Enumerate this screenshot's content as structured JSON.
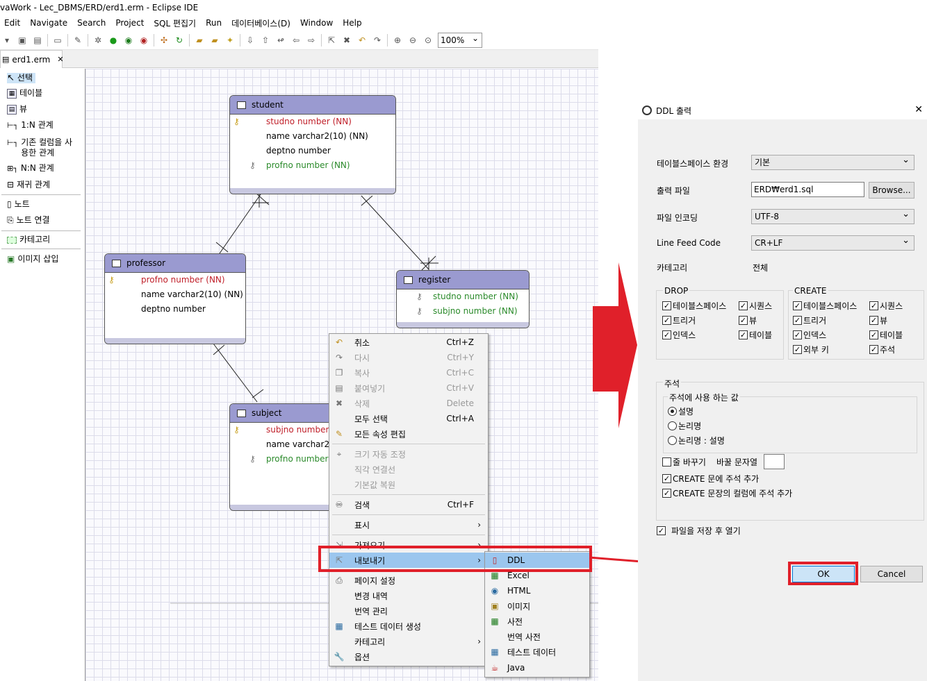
{
  "window": {
    "title": "vaWork - Lec_DBMS/ERD/erd1.erm - Eclipse IDE"
  },
  "menubar": [
    "Edit",
    "Navigate",
    "Search",
    "Project",
    "SQL 편집기",
    "Run",
    "데이터베이스(D)",
    "Window",
    "Help"
  ],
  "toolbar": {
    "zoom": "100%"
  },
  "editor_tab": {
    "label": "erd1.erm"
  },
  "palette": {
    "items": [
      "선택",
      "테이블",
      "뷰",
      "1:N 관계",
      "기존 컬럼을 사용한 관계",
      "N:N 관계",
      "재귀 관계",
      "노트",
      "노트 연결",
      "카테고리",
      "이미지 삽입"
    ],
    "item5_line1": "기존 컬럼을 사",
    "item5_line2": "용한 관계"
  },
  "entities": {
    "student": {
      "name": "student",
      "cols": [
        "studno number (NN)",
        "name varchar2(10) (NN)",
        "deptno number",
        "profno number (NN)"
      ]
    },
    "professor": {
      "name": "professor",
      "cols": [
        "profno number (NN)",
        "name varchar2(10) (NN)",
        "deptno number"
      ]
    },
    "register": {
      "name": "register",
      "cols": [
        "studno number (NN)",
        "subjno number (NN)"
      ]
    },
    "subject": {
      "name": "subject",
      "cols": [
        "subjno number (",
        "name varchar2(1",
        "profno number ("
      ]
    }
  },
  "context_menu": {
    "items": [
      {
        "label": "취소",
        "shortcut": "Ctrl+Z"
      },
      {
        "label": "다시",
        "shortcut": "Ctrl+Y"
      },
      {
        "label": "복사",
        "shortcut": "Ctrl+C"
      },
      {
        "label": "붙여넣기",
        "shortcut": "Ctrl+V"
      },
      {
        "label": "삭제",
        "shortcut": "Delete"
      },
      {
        "label": "모두 선택",
        "shortcut": "Ctrl+A"
      },
      {
        "label": "모든 속성 편집",
        "shortcut": ""
      },
      {
        "label": "크기 자동 조정",
        "shortcut": ""
      },
      {
        "label": "직각 연결선",
        "shortcut": ""
      },
      {
        "label": "기본값 복원",
        "shortcut": ""
      },
      {
        "label": "검색",
        "shortcut": "Ctrl+F"
      },
      {
        "label": "표시",
        "shortcut": ""
      },
      {
        "label": "가져오기",
        "shortcut": ""
      },
      {
        "label": "내보내기",
        "shortcut": ""
      },
      {
        "label": "페이지 설정",
        "shortcut": ""
      },
      {
        "label": "변경 내역",
        "shortcut": ""
      },
      {
        "label": "번역 관리",
        "shortcut": ""
      },
      {
        "label": "테스트 데이터 생성",
        "shortcut": ""
      },
      {
        "label": "카테고리",
        "shortcut": ""
      },
      {
        "label": "옵션",
        "shortcut": ""
      }
    ]
  },
  "export_submenu": {
    "items": [
      "DDL",
      "Excel",
      "HTML",
      "이미지",
      "사전",
      "번역 사전",
      "테스트 데이터",
      "Java"
    ]
  },
  "dialog": {
    "title": "DDL 출력",
    "tablespace_label": "테이블스페이스 환경",
    "tablespace_value": "기본",
    "output_file_label": "출력 파일",
    "output_file_value": "ERD₩erd1.sql",
    "browse_label": "Browse...",
    "encoding_label": "파일 인코딩",
    "encoding_value": "UTF-8",
    "linefeed_label": "Line Feed Code",
    "linefeed_value": "CR+LF",
    "category_label": "카테고리",
    "category_value": "전체",
    "drop": {
      "title": "DROP",
      "items": [
        "테이블스페이스",
        "시퀀스",
        "트리거",
        "뷰",
        "인덱스",
        "테이블"
      ]
    },
    "create": {
      "title": "CREATE",
      "items": [
        "테이블스페이스",
        "시퀀스",
        "트리거",
        "뷰",
        "인덱스",
        "테이블",
        "외부 키",
        "주석"
      ]
    },
    "comment": {
      "title": "주석",
      "value_title": "주석에 사용 하는 값",
      "options": [
        "설명",
        "논리명",
        "논리명 : 설명"
      ],
      "selected": "설명",
      "wrap_label": "줄 바꾸기",
      "wrap_char_label": "바꿀 문자열",
      "add_comment_create": "CREATE 문에 주석 추가",
      "add_comment_columns": "CREATE 문장의 컬럼에 주석 추가"
    },
    "open_after_save": "파일을 저장 후 열기",
    "ok_label": "OK",
    "cancel_label": "Cancel"
  },
  "annotation_color": "#e0202a"
}
